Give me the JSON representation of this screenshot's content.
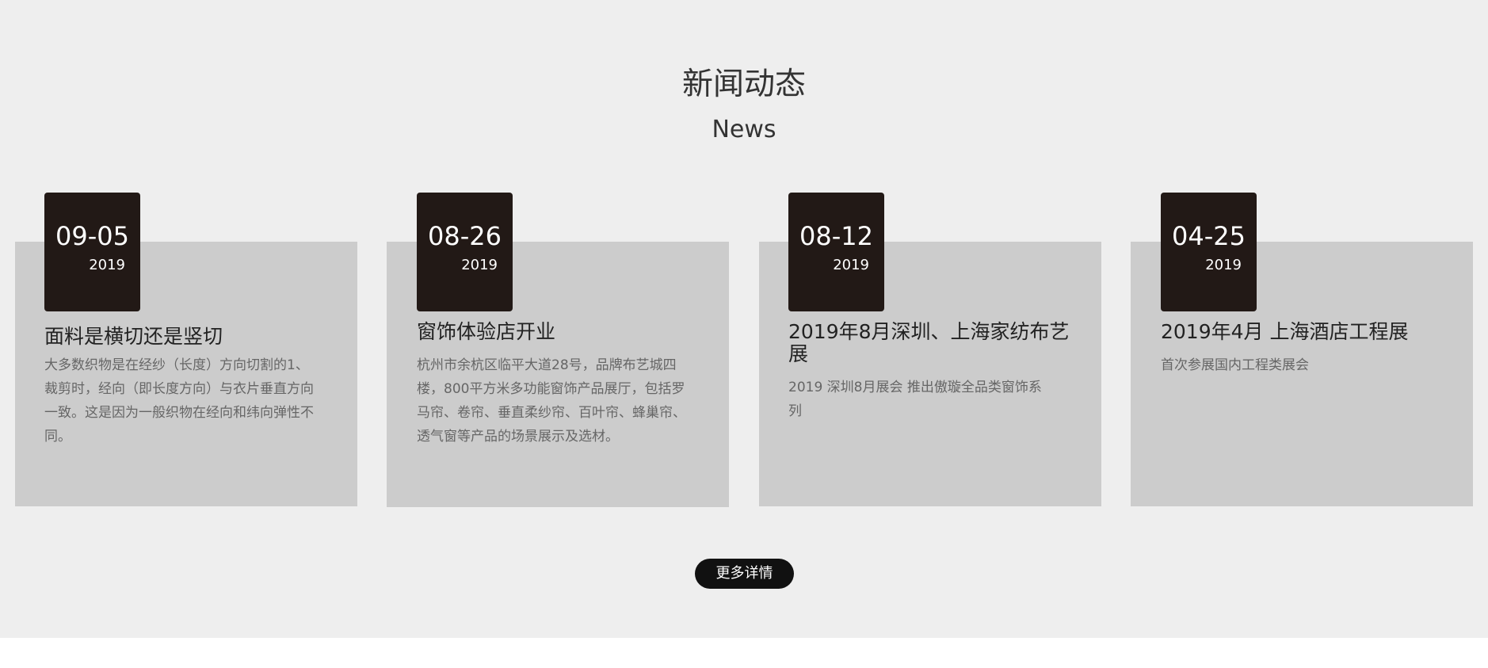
{
  "section": {
    "title": "新闻动态",
    "subtitle": "News"
  },
  "news": [
    {
      "date": "09-05",
      "year": "2019",
      "title": "面料是横切还是竖切",
      "description": "大多数织物是在经纱（长度）方向切割的1、裁剪时，经向（即长度方向）与衣片垂直方向一致。这是因为一般织物在经向和纬向弹性不同。"
    },
    {
      "date": "08-26",
      "year": "2019",
      "title": "窗饰体验店开业",
      "description": "杭州市余杭区临平大道28号，品牌布艺城四楼，800平方米多功能窗饰产品展厅，包括罗马帘、卷帘、垂直柔纱帘、百叶帘、蜂巢帘、透气窗等产品的场景展示及选材。"
    },
    {
      "date": "08-12",
      "year": "2019",
      "title": "2019年8月深圳、上海家纺布艺展",
      "description": "2019 深圳8月展会 推出傲璇全品类窗饰系列"
    },
    {
      "date": "04-25",
      "year": "2019",
      "title": "2019年4月 上海酒店工程展",
      "description": "首次参展国内工程类展会"
    }
  ],
  "more_button": {
    "label": "更多详情"
  },
  "colors": {
    "section_bg": "#eeeeee",
    "card_bg": "#cccccc",
    "badge_bg": "#221916",
    "button_bg": "#111111"
  }
}
